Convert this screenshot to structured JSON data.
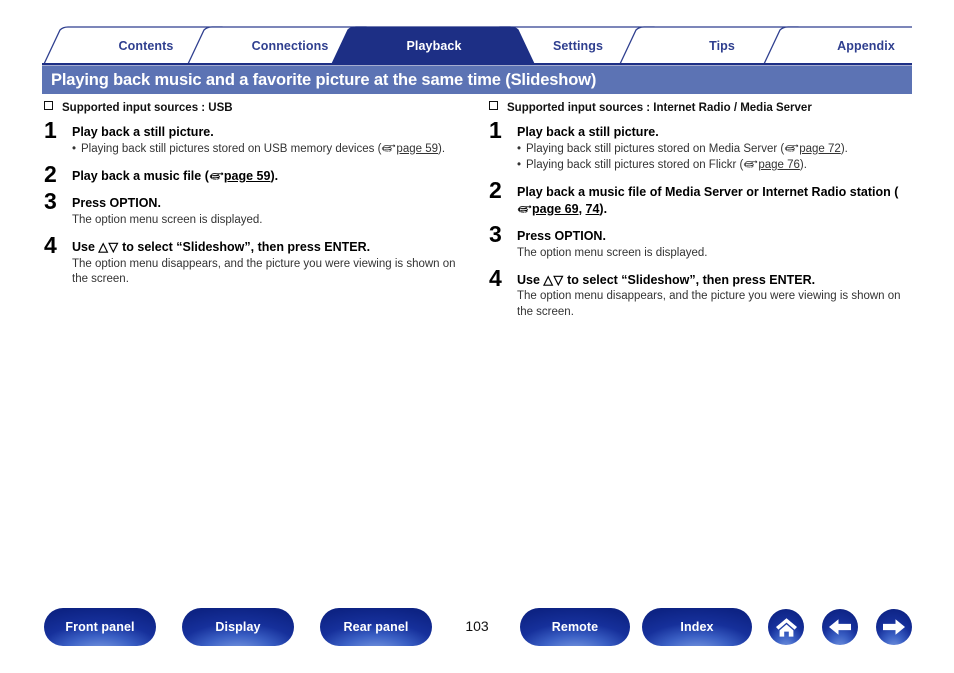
{
  "tabs": [
    {
      "label": "Contents",
      "active": false
    },
    {
      "label": "Connections",
      "active": false
    },
    {
      "label": "Playback",
      "active": true
    },
    {
      "label": "Settings",
      "active": false
    },
    {
      "label": "Tips",
      "active": false
    },
    {
      "label": "Appendix",
      "active": false
    }
  ],
  "page_title": "Playing back music and a favorite picture at the same time (Slideshow)",
  "columns": [
    {
      "section_heading": "Supported input sources : USB",
      "steps": [
        {
          "num": "1",
          "title": "Play back a still picture.",
          "bullets": [
            {
              "line1": "Playing  back  still  pictures  stored  on  USB  memory  devices",
              "line2_pre": "(",
              "link": "page 59",
              "line2_post": ")."
            }
          ],
          "desc": ""
        },
        {
          "num": "2",
          "title_pre": "Play back a music file (",
          "title_link": "page 59",
          "title_post": ").",
          "desc": ""
        },
        {
          "num": "3",
          "title": "Press OPTION.",
          "desc": "The option menu screen is displayed."
        },
        {
          "num": "4",
          "title_pre": "Use ",
          "title_triangles": "△▽",
          "title_post": " to select “Slideshow”, then press ENTER.",
          "desc": "The option menu disappears, and the picture you were viewing is shown on the screen."
        }
      ]
    },
    {
      "section_heading": "Supported input sources : Internet Radio / Media Server",
      "steps": [
        {
          "num": "1",
          "title": "Play back a still picture.",
          "bullets": [
            {
              "line1_pre": "Playing back still pictures stored on Media Server (",
              "link": "page 72",
              "line1_post": ")."
            },
            {
              "line1_pre": "Playing back still pictures stored on Flickr (",
              "link": "page 76",
              "line1_post": ")."
            }
          ],
          "desc": ""
        },
        {
          "num": "2",
          "title_pre": "Play back a music file of Media Server or Internet Radio station (",
          "title_link": "page 69",
          "title_link2": "74",
          "title_sep": ", ",
          "title_post": ").",
          "desc": ""
        },
        {
          "num": "3",
          "title": "Press OPTION.",
          "desc": "The option menu screen is displayed."
        },
        {
          "num": "4",
          "title_pre": "Use ",
          "title_triangles": "△▽",
          "title_post": " to select “Slideshow”, then press ENTER.",
          "desc": "The option menu disappears, and the picture you were viewing is shown on the screen."
        }
      ]
    }
  ],
  "footer": {
    "buttons": [
      {
        "label": "Front panel"
      },
      {
        "label": "Display"
      },
      {
        "label": "Rear panel"
      },
      {
        "label": "Remote"
      },
      {
        "label": "Index"
      }
    ],
    "page_number": "103",
    "icon_buttons": [
      {
        "icon": "home-icon"
      },
      {
        "icon": "arrow-left-icon"
      },
      {
        "icon": "arrow-right-icon"
      }
    ]
  },
  "colors": {
    "active_tab": "#1d2f85",
    "tab_text": "#2f3f8f",
    "title_bar": "#5c73b4",
    "button_blue": "#16309b"
  }
}
